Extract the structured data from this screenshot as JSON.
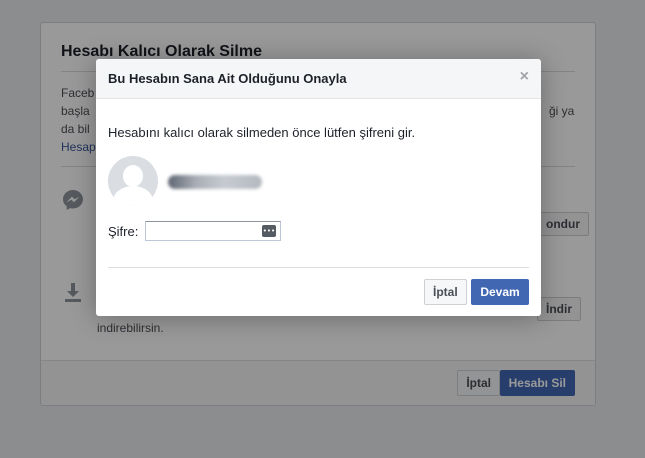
{
  "background": {
    "title": "Hesabı Kalıcı Olarak Silme",
    "para_line1_left": "Faceb",
    "para_line2_left": "başla",
    "para_line2_right": "ği ya",
    "para_line3_left": "da bil",
    "link_left": "Hesap",
    "section2_text_tail": "indirebilirsin.",
    "side_button_1": "ondur",
    "side_button_2": "İndir",
    "footer_cancel": "İptal",
    "footer_delete": "Hesabı Sil"
  },
  "modal": {
    "title": "Bu Hesabın Sana Ait Olduğunu Onayla",
    "close": "×",
    "message": "Hesabını kalıcı olarak silmeden önce lütfen şifreni gir.",
    "password_label": "Şifre:",
    "password_value": "",
    "cancel": "İptal",
    "continue": "Devam"
  },
  "colors": {
    "primary": "#4267b2",
    "link": "#365899",
    "overlay": "rgba(0,0,0,0.4)"
  }
}
